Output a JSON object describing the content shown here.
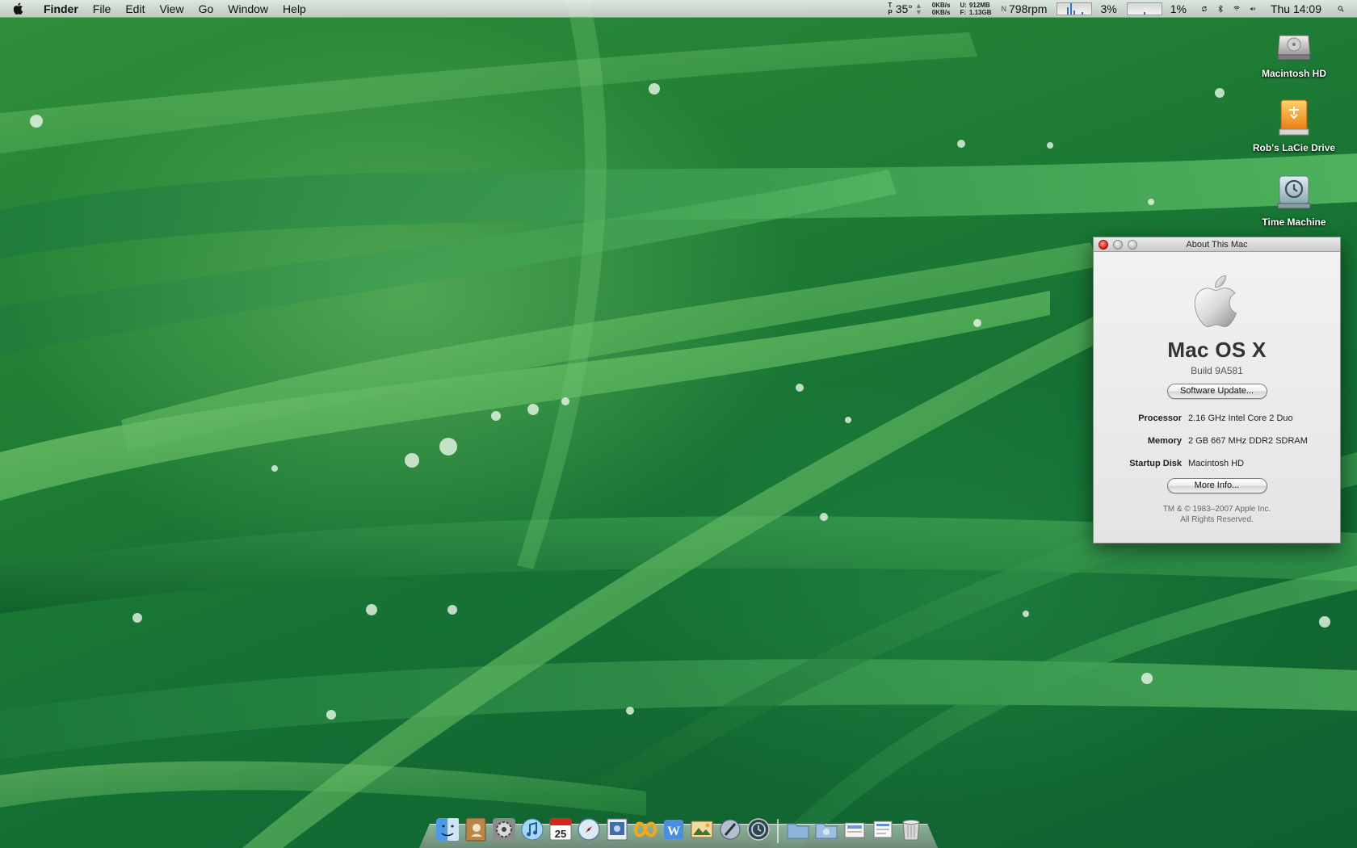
{
  "menubar": {
    "app_name": "Finder",
    "menus": [
      "File",
      "Edit",
      "View",
      "Go",
      "Window",
      "Help"
    ],
    "status": {
      "temp_top": "T",
      "temp_bottom": "P",
      "temperature": "35°",
      "net_up": "0KB/s",
      "net_down": "0KB/s",
      "mem_u_label": "U:",
      "mem_f_label": "F:",
      "mem_used": "912MB",
      "mem_free": "1.13GB",
      "fan_label": "N",
      "fan": "798rpm",
      "cpu1": "3%",
      "cpu2": "1%",
      "clock": "Thu 14:09"
    }
  },
  "desktop_icons": [
    {
      "label": "Macintosh HD",
      "icon": "hard-drive-icon"
    },
    {
      "label": "Rob's LaCie Drive",
      "icon": "external-drive-icon"
    },
    {
      "label": "Time Machine",
      "icon": "time-machine-icon"
    }
  ],
  "about_window": {
    "title": "About This Mac",
    "os_name": "Mac OS X",
    "build": "Build 9A581",
    "software_update_label": "Software Update...",
    "rows": [
      {
        "key": "Processor",
        "value": "2.16 GHz Intel Core 2 Duo"
      },
      {
        "key": "Memory",
        "value": "2 GB 667 MHz DDR2 SDRAM"
      },
      {
        "key": "Startup Disk",
        "value": "Macintosh HD"
      }
    ],
    "more_info_label": "More Info...",
    "copyright_line1": "TM & © 1983–2007 Apple Inc.",
    "copyright_line2": "All Rights Reserved."
  },
  "dock": {
    "apps": [
      "finder-icon",
      "address-book-icon",
      "system-preferences-icon",
      "itunes-icon",
      "ical-icon",
      "safari-icon",
      "preview-icon",
      "office-icon",
      "word-icon",
      "iphoto-icon",
      "script-editor-icon",
      "time-machine-icon"
    ],
    "stacks": [
      "applications-folder-icon",
      "documents-folder-icon",
      "downloads-stack-icon",
      "files-stack-icon",
      "trash-icon"
    ]
  },
  "colors": {
    "wallpaper": "#1f7d34",
    "close_button": "#d2251c",
    "accent_blue": "#2f6fd0"
  }
}
